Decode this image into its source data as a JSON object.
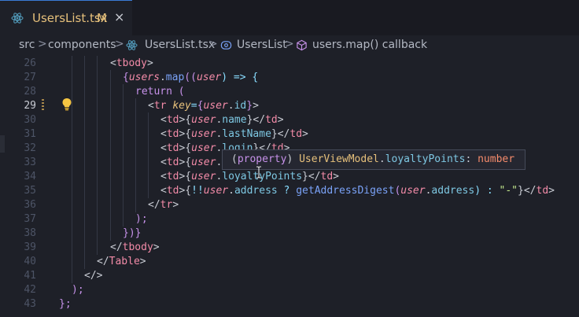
{
  "tab": {
    "filename": "UsersList.tsx",
    "status": "M",
    "close": "×"
  },
  "breadcrumb": {
    "items": [
      "src",
      "components",
      "UsersList.tsx",
      "UsersList",
      "users.map() callback"
    ],
    "sep": ">"
  },
  "editor": {
    "active_line": "29",
    "lines": [
      {
        "n": "26"
      },
      {
        "n": "27"
      },
      {
        "n": "28"
      },
      {
        "n": "29"
      },
      {
        "n": "30"
      },
      {
        "n": "31"
      },
      {
        "n": "32"
      },
      {
        "n": "33"
      },
      {
        "n": "34"
      },
      {
        "n": "35"
      },
      {
        "n": "36"
      },
      {
        "n": "37"
      },
      {
        "n": "38"
      },
      {
        "n": "39"
      },
      {
        "n": "40"
      },
      {
        "n": "41"
      },
      {
        "n": "42"
      },
      {
        "n": "43"
      }
    ],
    "code": {
      "l26": [
        "<",
        "tbody",
        ">"
      ],
      "l27": [
        "{",
        "users",
        ".",
        "map",
        "((",
        "user",
        ") => {"
      ],
      "l28": [
        "return",
        " ("
      ],
      "l29": [
        "<",
        "tr",
        " ",
        "key",
        "=",
        "{",
        "user",
        ".",
        "id",
        "}",
        ">"
      ],
      "l30": [
        "<",
        "td",
        ">{",
        "user",
        ".",
        "name",
        "}</",
        "td",
        ">"
      ],
      "l31": [
        "<",
        "td",
        ">{",
        "user",
        ".",
        "lastName",
        "}</",
        "td",
        ">"
      ],
      "l32": [
        "<",
        "td",
        ">{",
        "user",
        ".",
        "login",
        "}</",
        "td",
        ">"
      ],
      "l33": [
        "<",
        "td",
        ">{",
        "user",
        "."
      ],
      "l34": [
        "<",
        "td",
        ">{",
        "user",
        ".",
        "loyaltyPoints",
        "}</",
        "td",
        ">"
      ],
      "l35": [
        "<",
        "td",
        ">{",
        "!!",
        "user",
        ".",
        "address",
        " ? ",
        "getAddressDigest",
        "(",
        "user",
        ".",
        "address",
        ") : ",
        "\"-\"",
        "}</",
        "td",
        ">"
      ],
      "l36": [
        "</",
        "tr",
        ">"
      ],
      "l37": [
        ");"
      ],
      "l38": [
        "})}"
      ],
      "l39": [
        "</",
        "tbody",
        ">"
      ],
      "l40": [
        "</",
        "Table",
        ">"
      ],
      "l41": [
        "</>"
      ],
      "l42": [
        ");"
      ],
      "l43": [
        "};"
      ]
    }
  },
  "tooltip": {
    "open": "(",
    "kind": "property",
    "close": ")",
    "type": "UserViewModel",
    "dot": ".",
    "property": "loyaltyPoints",
    "colon": ":",
    "returns": "number"
  },
  "icons": [
    "react-icon",
    "symbol-class-icon",
    "cube-icon",
    "lightbulb-icon",
    "close-icon"
  ]
}
